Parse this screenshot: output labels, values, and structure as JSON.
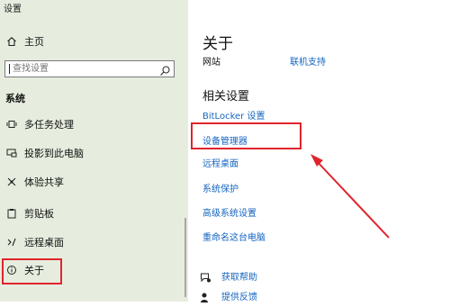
{
  "window": {
    "title": "设置"
  },
  "sidebar": {
    "home": {
      "label": "主页",
      "icon": "home-icon"
    },
    "search": {
      "placeholder": "查找设置",
      "icon": "search-icon"
    },
    "section_title": "系统",
    "items": [
      {
        "label": "多任务处理",
        "icon": "multitask-icon"
      },
      {
        "label": "投影到此电脑",
        "icon": "project-icon"
      },
      {
        "label": "体验共享",
        "icon": "share-experience-icon"
      },
      {
        "label": "剪贴板",
        "icon": "clipboard-icon"
      },
      {
        "label": "远程桌面",
        "icon": "remote-desktop-icon"
      },
      {
        "label": "关于",
        "icon": "info-icon",
        "selected": true
      }
    ]
  },
  "main": {
    "title": "关于",
    "website_label": "网站",
    "online_support_link": "联机支持",
    "related_title": "相关设置",
    "related_links": [
      "BitLocker 设置",
      "设备管理器",
      "远程桌面",
      "系统保护",
      "高级系统设置",
      "重命名这台电脑"
    ],
    "support_links": [
      {
        "label": "获取帮助",
        "icon": "help-chat-icon"
      },
      {
        "label": "提供反馈",
        "icon": "feedback-icon"
      }
    ]
  },
  "annotations": {
    "highlight_color": "#e0242c"
  },
  "colors": {
    "sidebar_bg": "#e6edde",
    "link": "#1565c0",
    "accent": "#e0242c"
  }
}
